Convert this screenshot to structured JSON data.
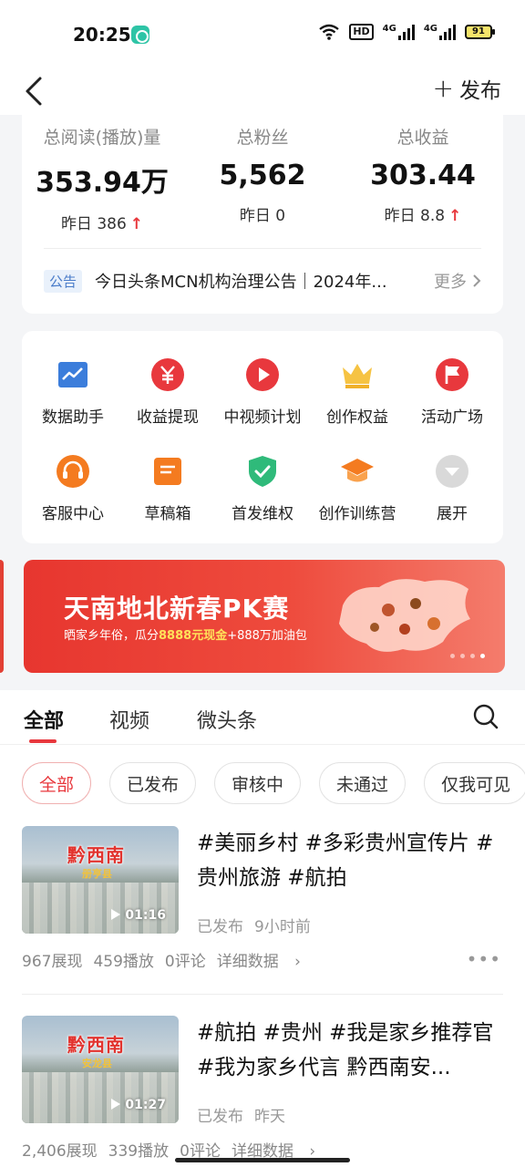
{
  "status_bar": {
    "time": "20:25",
    "hd": "HD",
    "sig1": "4G",
    "sig2": "4G",
    "battery": "91"
  },
  "header": {
    "publish_label": "发布"
  },
  "stats": [
    {
      "label": "总阅读(播放)量",
      "value": "353.94万",
      "yesterday": "昨日 386",
      "trend": "up"
    },
    {
      "label": "总粉丝",
      "value": "5,562",
      "yesterday": "昨日 0",
      "trend": "none"
    },
    {
      "label": "总收益",
      "value": "303.44",
      "yesterday": "昨日 8.8",
      "trend": "up"
    }
  ],
  "notice": {
    "tag": "公告",
    "text": "今日头条MCN机构治理公告｜2024年...",
    "more": "更多"
  },
  "tools": [
    {
      "label": "数据助手",
      "icon": "chart-icon"
    },
    {
      "label": "收益提现",
      "icon": "yuan-icon"
    },
    {
      "label": "中视频计划",
      "icon": "play-icon"
    },
    {
      "label": "创作权益",
      "icon": "crown-icon"
    },
    {
      "label": "活动广场",
      "icon": "flag-icon"
    },
    {
      "label": "客服中心",
      "icon": "headset-icon"
    },
    {
      "label": "草稿箱",
      "icon": "draft-icon"
    },
    {
      "label": "首发维权",
      "icon": "shield-icon"
    },
    {
      "label": "创作训练营",
      "icon": "graduation-cap-icon"
    },
    {
      "label": "展开",
      "icon": "chevron-down-icon"
    }
  ],
  "banner": {
    "title": "天南地北新春PK赛",
    "subtitle_pre": "晒家乡年俗，瓜分",
    "subtitle_highlight": "8888元现金",
    "subtitle_post": "+888万加油包",
    "active_dot": 4,
    "dot_count": 4
  },
  "tabs": [
    {
      "label": "全部",
      "active": true
    },
    {
      "label": "视频",
      "active": false
    },
    {
      "label": "微头条",
      "active": false
    }
  ],
  "filters": [
    {
      "label": "全部",
      "active": true
    },
    {
      "label": "已发布",
      "active": false
    },
    {
      "label": "审核中",
      "active": false
    },
    {
      "label": "未通过",
      "active": false
    },
    {
      "label": "仅我可见",
      "active": false
    }
  ],
  "posts": [
    {
      "thumb_title": "黔西南",
      "thumb_subtitle": "册亨县",
      "duration": "01:16",
      "title": "#美丽乡村 #多彩贵州宣传片 #贵州旅游 #航拍",
      "status": "已发布",
      "time": "9小时前",
      "impressions": "967展现",
      "plays": "459播放",
      "comments": "0评论",
      "detail": "详细数据"
    },
    {
      "thumb_title": "黔西南",
      "thumb_subtitle": "安龙县",
      "duration": "01:27",
      "title": "#航拍 #贵州 #我是家乡推荐官 #我为家乡代言 黔西南安...",
      "status": "已发布",
      "time": "昨天",
      "impressions": "2,406展现",
      "plays": "339播放",
      "comments": "0评论",
      "detail": "详细数据"
    }
  ],
  "colors": {
    "accent": "#e8383d",
    "blue": "#3b7ddb",
    "orange": "#f47b20",
    "green": "#2fba7a",
    "gold": "#f6c343"
  }
}
